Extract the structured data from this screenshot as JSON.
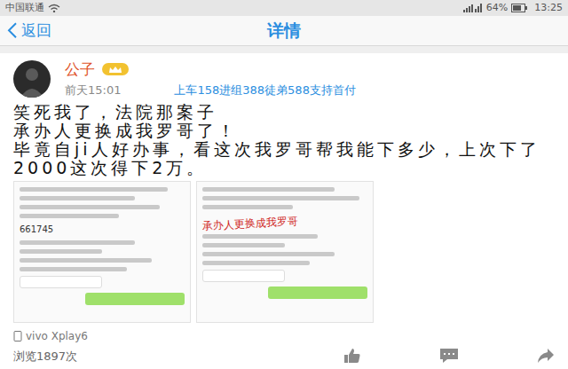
{
  "status_bar": {
    "carrier": "中国联通",
    "battery": "64%",
    "time": "13:25"
  },
  "header": {
    "back": "返回",
    "title": "详情"
  },
  "post": {
    "author": "公子",
    "time": "前天15:01",
    "tagline": "上车158进组388徒弟588支持首付",
    "lines": [
      "笑死我了，法院那案子",
      "承办人更换成我罗哥了！",
      "毕竟自ji人好办事，看这次我罗哥帮我能下多少，上次下了2000这次得下2万。"
    ],
    "images": [
      {
        "texts": [
          "661745"
        ]
      },
      {
        "texts": [
          "承办人更换成我罗哥"
        ]
      }
    ],
    "device": "vivo Xplay6",
    "views": "浏览1897次"
  }
}
